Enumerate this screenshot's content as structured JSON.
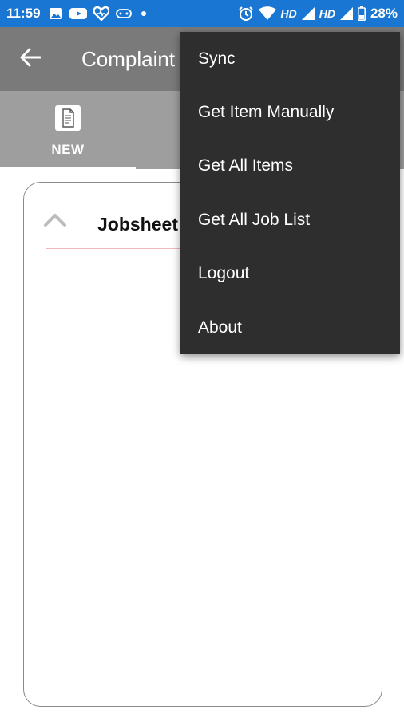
{
  "status_bar": {
    "time": "11:59",
    "network_label_1": "HD",
    "network_label_2": "HD",
    "battery": "28%",
    "icons": [
      "image-icon",
      "youtube-icon",
      "heart-app-icon",
      "game-controller-icon",
      "dot-icon",
      "alarm-icon",
      "wifi-icon",
      "signal-icon",
      "battery-icon"
    ]
  },
  "toolbar": {
    "back_icon": "arrow-left-icon",
    "title": "Complaint"
  },
  "tabs": [
    {
      "label": "NEW",
      "icon": "document-icon"
    }
  ],
  "card": {
    "title": "Jobsheet",
    "chevron_icon": "chevron-up-icon"
  },
  "menu": {
    "items": [
      {
        "label": "Sync"
      },
      {
        "label": "Get Item Manually"
      },
      {
        "label": "Get All Items"
      },
      {
        "label": "Get All Job List"
      },
      {
        "label": "Logout"
      },
      {
        "label": "About"
      }
    ]
  },
  "colors": {
    "status_bar": "#1976d2",
    "toolbar": "#7a7a7a",
    "tabs": "#9e9e9e",
    "menu_bg": "#2e2e2e",
    "divider": "#f0b8b8"
  }
}
